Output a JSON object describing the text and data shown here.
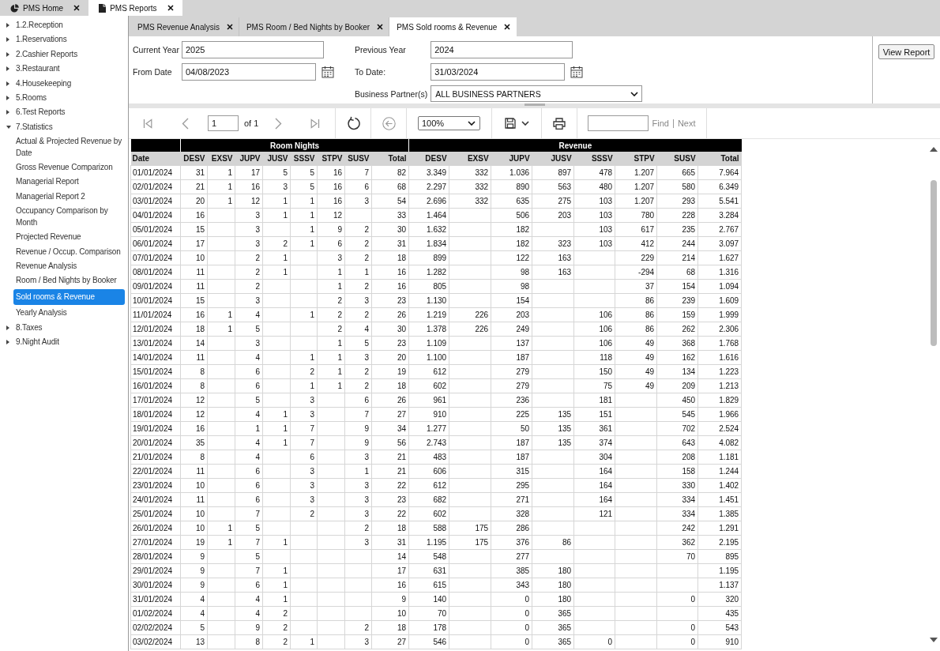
{
  "app_tabs": [
    {
      "label": "PMS Home",
      "kind": "home",
      "selected": false
    },
    {
      "label": "PMS Reports",
      "kind": "reports",
      "selected": true
    }
  ],
  "sidebar": {
    "items": [
      {
        "label": "1.2.Reception",
        "expanded": false
      },
      {
        "label": "1.Reservations",
        "expanded": false
      },
      {
        "label": "2.Cashier Reports",
        "expanded": false
      },
      {
        "label": "3.Restaurant",
        "expanded": false
      },
      {
        "label": "4.Housekeeping",
        "expanded": false
      },
      {
        "label": "5.Rooms",
        "expanded": false
      },
      {
        "label": "6.Test Reports",
        "expanded": false
      },
      {
        "label": "7.Statistics",
        "expanded": true,
        "children": [
          {
            "label": "Actual & Projected Revenue by Date",
            "selected": false
          },
          {
            "label": "Gross Revenue Comparizon",
            "selected": false
          },
          {
            "label": "Managerial Report",
            "selected": false
          },
          {
            "label": "Managerial Report 2",
            "selected": false
          },
          {
            "label": "Occupancy Comparison by Month",
            "selected": false
          },
          {
            "label": "Projected Revenue",
            "selected": false
          },
          {
            "label": "Revenue / Occup. Comparison",
            "selected": false
          },
          {
            "label": "Revenue Analysis",
            "selected": false
          },
          {
            "label": "Room / Bed Nights by Booker",
            "selected": false
          },
          {
            "label": "Sold rooms & Revenue",
            "selected": true
          },
          {
            "label": "Yearly Analysis",
            "selected": false
          }
        ]
      },
      {
        "label": "8.Taxes",
        "expanded": false
      },
      {
        "label": "9.Night Audit",
        "expanded": false
      }
    ]
  },
  "report_tabs": [
    {
      "label": "PMS Revenue Analysis",
      "selected": false
    },
    {
      "label": "PMS Room / Bed Nights by Booker",
      "selected": false
    },
    {
      "label": "PMS Sold rooms & Revenue",
      "selected": true
    }
  ],
  "parameters": {
    "left": [
      {
        "kind": "text",
        "label": "Current Year",
        "value": "2025"
      },
      {
        "kind": "date",
        "label": "From Date",
        "value": "04/08/2023"
      }
    ],
    "right": [
      {
        "kind": "text",
        "label": "Previous Year",
        "value": "2024"
      },
      {
        "kind": "date",
        "label": "To Date:",
        "value": "31/03/2024"
      },
      {
        "kind": "select",
        "label": "Business Partner(s)",
        "value": "ALL BUSINESS PARTNERS"
      }
    ],
    "button": "View Report"
  },
  "toolbar": {
    "groups": [
      [
        {
          "kind": "first",
          "disabled": true
        },
        {
          "kind": "previous",
          "disabled": true
        },
        {
          "kind": "page",
          "value": "1",
          "total": "of 1"
        },
        {
          "kind": "next",
          "disabled": true
        },
        {
          "kind": "last",
          "disabled": true
        }
      ],
      [
        {
          "kind": "refresh",
          "disabled": false
        }
      ],
      [
        {
          "kind": "back",
          "disabled": true
        }
      ],
      [
        {
          "kind": "zoom",
          "value": "100%"
        }
      ],
      [
        {
          "kind": "export",
          "disabled": false
        }
      ],
      [
        {
          "kind": "print",
          "disabled": false
        }
      ],
      [
        {
          "kind": "find",
          "find_label": "Find",
          "next_label": "Next",
          "disabled": true
        }
      ]
    ]
  },
  "table": {
    "first_column": "Date",
    "groups": [
      {
        "label": "Room Nights",
        "columns": [
          "DESV",
          "EXSV",
          "JUPV",
          "JUSV",
          "SSSV",
          "STPV",
          "SUSV",
          "Total"
        ]
      },
      {
        "label": "Revenue",
        "columns": [
          "DESV",
          "EXSV",
          "JUPV",
          "JUSV",
          "SSSV",
          "STPV",
          "SUSV",
          "Total"
        ]
      }
    ],
    "rows": [
      [
        "01/01/2024",
        "31",
        "1",
        "17",
        "5",
        "5",
        "16",
        "7",
        "82",
        "3.349",
        "332",
        "1.036",
        "897",
        "478",
        "1.207",
        "665",
        "7.964"
      ],
      [
        "02/01/2024",
        "21",
        "1",
        "16",
        "3",
        "5",
        "16",
        "6",
        "68",
        "2.297",
        "332",
        "890",
        "563",
        "480",
        "1.207",
        "580",
        "6.349"
      ],
      [
        "03/01/2024",
        "20",
        "1",
        "12",
        "1",
        "1",
        "16",
        "3",
        "54",
        "2.696",
        "332",
        "635",
        "275",
        "103",
        "1.207",
        "293",
        "5.541"
      ],
      [
        "04/01/2024",
        "16",
        null,
        "3",
        "1",
        "1",
        "12",
        null,
        "33",
        "1.464",
        null,
        "506",
        "203",
        "103",
        "780",
        "228",
        "3.284"
      ],
      [
        "05/01/2024",
        "15",
        null,
        "3",
        null,
        "1",
        "9",
        "2",
        "30",
        "1.632",
        null,
        "182",
        null,
        "103",
        "617",
        "235",
        "2.767"
      ],
      [
        "06/01/2024",
        "17",
        null,
        "3",
        "2",
        "1",
        "6",
        "2",
        "31",
        "1.834",
        null,
        "182",
        "323",
        "103",
        "412",
        "244",
        "3.097"
      ],
      [
        "07/01/2024",
        "10",
        null,
        "2",
        "1",
        null,
        "3",
        "2",
        "18",
        "899",
        null,
        "122",
        "163",
        null,
        "229",
        "214",
        "1.627"
      ],
      [
        "08/01/2024",
        "11",
        null,
        "2",
        "1",
        null,
        "1",
        "1",
        "16",
        "1.282",
        null,
        "98",
        "163",
        null,
        "-294",
        "68",
        "1.316"
      ],
      [
        "09/01/2024",
        "11",
        null,
        "2",
        null,
        null,
        "1",
        "2",
        "16",
        "805",
        null,
        "98",
        null,
        null,
        "37",
        "154",
        "1.094"
      ],
      [
        "10/01/2024",
        "15",
        null,
        "3",
        null,
        null,
        "2",
        "3",
        "23",
        "1.130",
        null,
        "154",
        null,
        null,
        "86",
        "239",
        "1.609"
      ],
      [
        "11/01/2024",
        "16",
        "1",
        "4",
        null,
        "1",
        "2",
        "2",
        "26",
        "1.219",
        "226",
        "203",
        null,
        "106",
        "86",
        "159",
        "1.999"
      ],
      [
        "12/01/2024",
        "18",
        "1",
        "5",
        null,
        null,
        "2",
        "4",
        "30",
        "1.378",
        "226",
        "249",
        null,
        "106",
        "86",
        "262",
        "2.306"
      ],
      [
        "13/01/2024",
        "14",
        null,
        "3",
        null,
        null,
        "1",
        "5",
        "23",
        "1.109",
        null,
        "137",
        null,
        "106",
        "49",
        "368",
        "1.768"
      ],
      [
        "14/01/2024",
        "11",
        null,
        "4",
        null,
        "1",
        "1",
        "3",
        "20",
        "1.100",
        null,
        "187",
        null,
        "118",
        "49",
        "162",
        "1.616"
      ],
      [
        "15/01/2024",
        "8",
        null,
        "6",
        null,
        "2",
        "1",
        "2",
        "19",
        "612",
        null,
        "279",
        null,
        "150",
        "49",
        "134",
        "1.223"
      ],
      [
        "16/01/2024",
        "8",
        null,
        "6",
        null,
        "1",
        "1",
        "2",
        "18",
        "602",
        null,
        "279",
        null,
        "75",
        "49",
        "209",
        "1.213"
      ],
      [
        "17/01/2024",
        "12",
        null,
        "5",
        null,
        "3",
        null,
        "6",
        "26",
        "961",
        null,
        "236",
        null,
        "181",
        null,
        "450",
        "1.829"
      ],
      [
        "18/01/2024",
        "12",
        null,
        "4",
        "1",
        "3",
        null,
        "7",
        "27",
        "910",
        null,
        "225",
        "135",
        "151",
        null,
        "545",
        "1.966"
      ],
      [
        "19/01/2024",
        "16",
        null,
        "1",
        "1",
        "7",
        null,
        "9",
        "34",
        "1.277",
        null,
        "50",
        "135",
        "361",
        null,
        "702",
        "2.524"
      ],
      [
        "20/01/2024",
        "35",
        null,
        "4",
        "1",
        "7",
        null,
        "9",
        "56",
        "2.743",
        null,
        "187",
        "135",
        "374",
        null,
        "643",
        "4.082"
      ],
      [
        "21/01/2024",
        "8",
        null,
        "4",
        null,
        "6",
        null,
        "3",
        "21",
        "483",
        null,
        "187",
        null,
        "304",
        null,
        "208",
        "1.181"
      ],
      [
        "22/01/2024",
        "11",
        null,
        "6",
        null,
        "3",
        null,
        "1",
        "21",
        "606",
        null,
        "315",
        null,
        "164",
        null,
        "158",
        "1.244"
      ],
      [
        "23/01/2024",
        "10",
        null,
        "6",
        null,
        "3",
        null,
        "3",
        "22",
        "612",
        null,
        "295",
        null,
        "164",
        null,
        "330",
        "1.402"
      ],
      [
        "24/01/2024",
        "11",
        null,
        "6",
        null,
        "3",
        null,
        "3",
        "23",
        "682",
        null,
        "271",
        null,
        "164",
        null,
        "334",
        "1.451"
      ],
      [
        "25/01/2024",
        "10",
        null,
        "7",
        null,
        "2",
        null,
        "3",
        "22",
        "602",
        null,
        "328",
        null,
        "121",
        null,
        "334",
        "1.385"
      ],
      [
        "26/01/2024",
        "10",
        "1",
        "5",
        null,
        null,
        null,
        "2",
        "18",
        "588",
        "175",
        "286",
        null,
        null,
        null,
        "242",
        "1.291"
      ],
      [
        "27/01/2024",
        "19",
        "1",
        "7",
        "1",
        null,
        null,
        "3",
        "31",
        "1.195",
        "175",
        "376",
        "86",
        null,
        null,
        "362",
        "2.195"
      ],
      [
        "28/01/2024",
        "9",
        null,
        "5",
        null,
        null,
        null,
        null,
        "14",
        "548",
        null,
        "277",
        null,
        null,
        null,
        "70",
        "895"
      ],
      [
        "29/01/2024",
        "9",
        null,
        "7",
        "1",
        null,
        null,
        null,
        "17",
        "631",
        null,
        "385",
        "180",
        null,
        null,
        null,
        "1.195"
      ],
      [
        "30/01/2024",
        "9",
        null,
        "6",
        "1",
        null,
        null,
        null,
        "16",
        "615",
        null,
        "343",
        "180",
        null,
        null,
        null,
        "1.137"
      ],
      [
        "31/01/2024",
        "4",
        null,
        "4",
        "1",
        null,
        null,
        null,
        "9",
        "140",
        null,
        "0",
        "180",
        null,
        null,
        "0",
        "320"
      ],
      [
        "01/02/2024",
        "4",
        null,
        "4",
        "2",
        null,
        null,
        null,
        "10",
        "70",
        null,
        "0",
        "365",
        null,
        null,
        null,
        "435"
      ],
      [
        "02/02/2024",
        "5",
        null,
        "9",
        "2",
        null,
        null,
        "2",
        "18",
        "178",
        null,
        "0",
        "365",
        null,
        null,
        "0",
        "543"
      ],
      [
        "03/02/2024",
        "13",
        null,
        "8",
        "2",
        "1",
        null,
        "3",
        "27",
        "546",
        null,
        "0",
        "365",
        "0",
        null,
        "0",
        "910"
      ]
    ]
  }
}
